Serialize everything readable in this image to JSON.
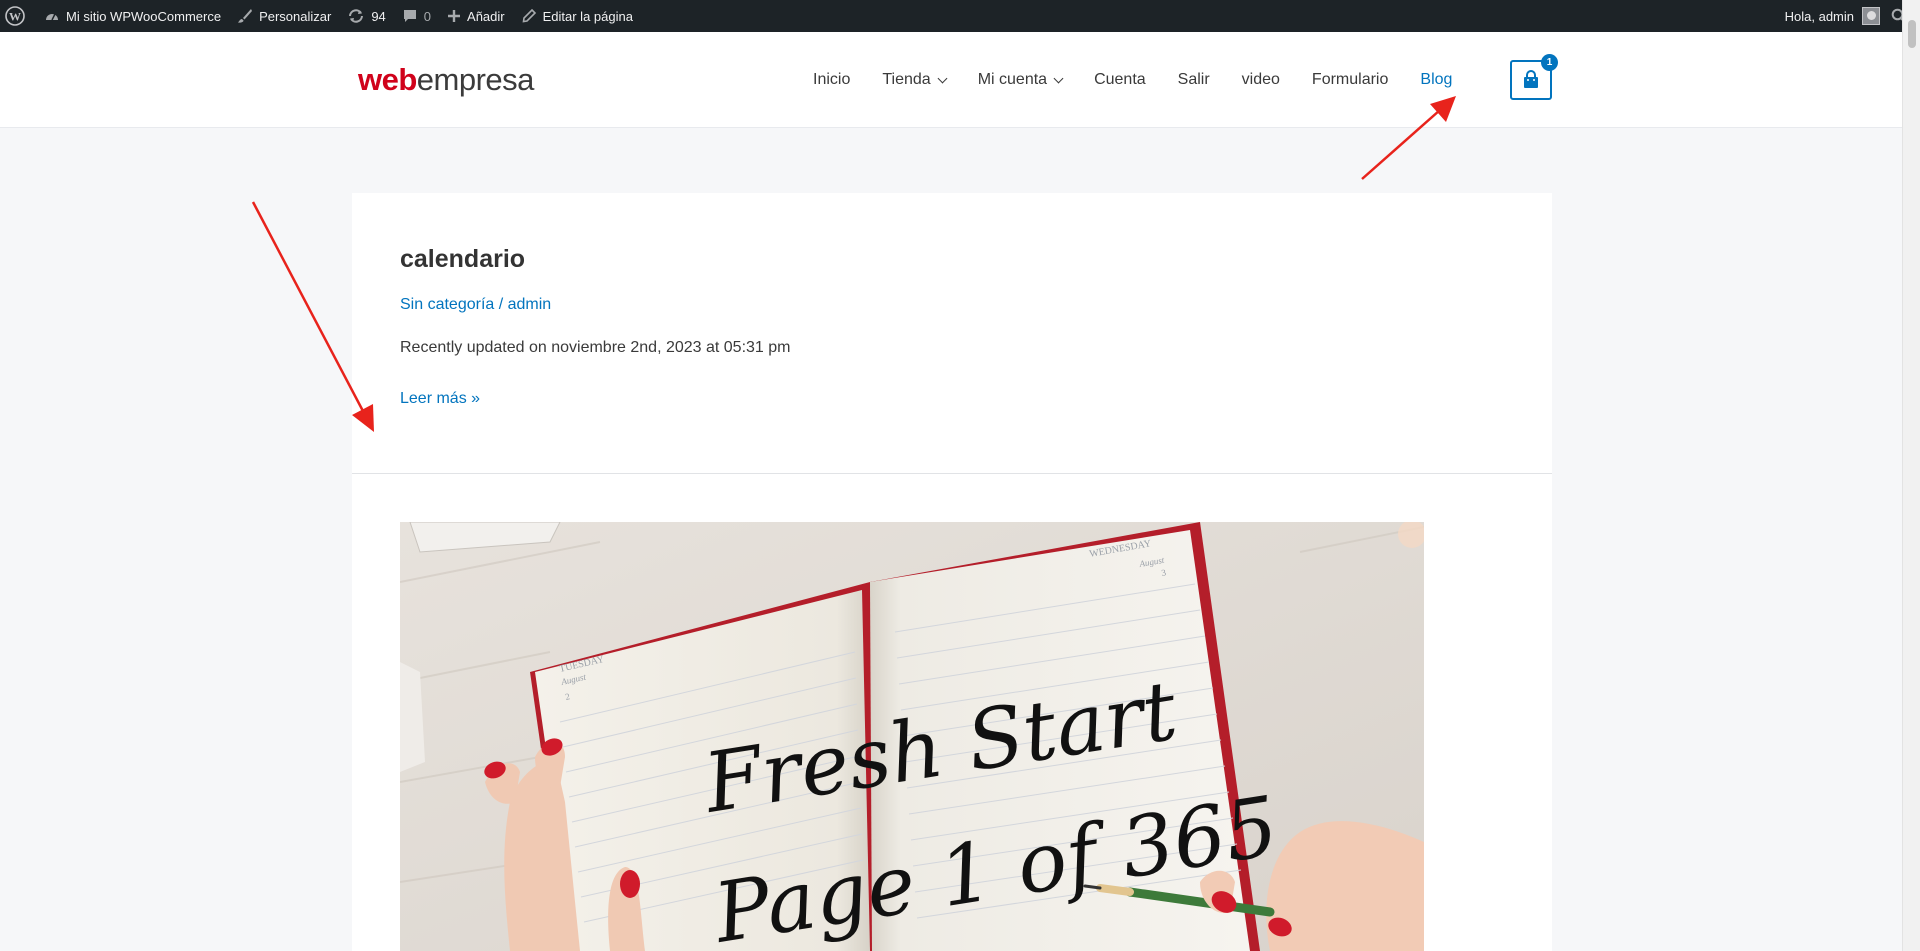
{
  "admin_bar": {
    "site_name": "Mi sitio WPWooCommerce",
    "customize": "Personalizar",
    "updates": "94",
    "comments": "0",
    "add_new": "Añadir",
    "edit_page": "Editar la página",
    "greeting": "Hola, admin"
  },
  "header": {
    "logo_part1": "web",
    "logo_part2": "empresa",
    "nav": [
      "Inicio",
      "Tienda",
      "Mi cuenta",
      "Cuenta",
      "Salir",
      "video",
      "Formulario",
      "Blog"
    ],
    "cart_count": "1"
  },
  "post": {
    "title": "calendario",
    "meta": "Sin categoría / admin",
    "updated": "Recently updated on noviembre 2nd, 2023 at 05:31 pm",
    "read_more": "Leer más »"
  },
  "featured_image": {
    "text_line1": "Fresh Start",
    "text_line2": "Page 1 of 365",
    "left_page_day": "TUESDAY",
    "left_page_month": "August",
    "left_page_num": "2",
    "right_page_day": "WEDNESDAY",
    "right_page_month": "August",
    "right_page_num": "3"
  },
  "colors": {
    "accent": "#0274be",
    "admin_bar": "#1d2327",
    "logo_red": "#d0021b",
    "annotation_arrow": "#e8231c"
  },
  "icons": [
    "wordpress-icon",
    "dashboard-icon",
    "brush-icon",
    "updates-icon",
    "comment-icon",
    "plus-icon",
    "pencil-icon",
    "search-icon",
    "shopping-bag-icon"
  ]
}
